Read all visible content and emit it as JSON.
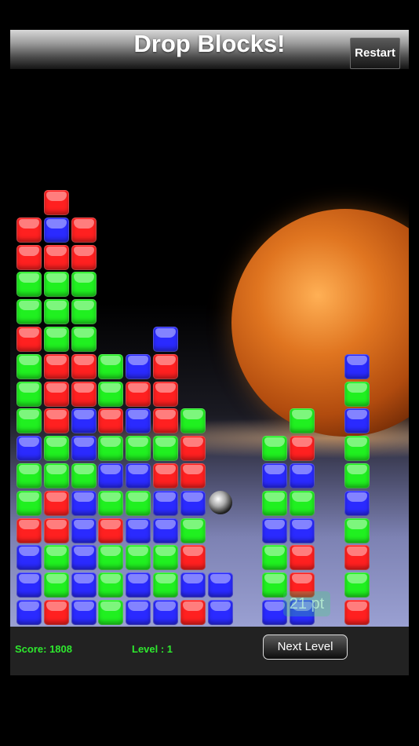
{
  "header": {
    "title": "Drop Blocks!",
    "restart_label": "Restart"
  },
  "board": {
    "colors": {
      "R": "#ff2020",
      "G": "#20f020",
      "B": "#2a2aff"
    },
    "columns": [
      [
        "B",
        "B",
        "B",
        "R",
        "G",
        "G",
        "B",
        "G",
        "G",
        "G",
        "R",
        "G",
        "G",
        "R",
        "R"
      ],
      [
        "R",
        "G",
        "G",
        "R",
        "R",
        "G",
        "G",
        "R",
        "R",
        "R",
        "G",
        "G",
        "G",
        "R",
        "B",
        "R"
      ],
      [
        "B",
        "B",
        "B",
        "B",
        "B",
        "G",
        "B",
        "B",
        "R",
        "R",
        "G",
        "G",
        "G",
        "R",
        "R"
      ],
      [
        "G",
        "G",
        "G",
        "R",
        "G",
        "B",
        "G",
        "R",
        "G",
        "G"
      ],
      [
        "B",
        "B",
        "G",
        "B",
        "G",
        "B",
        "G",
        "B",
        "R",
        "B"
      ],
      [
        "B",
        "G",
        "G",
        "B",
        "B",
        "R",
        "G",
        "R",
        "R",
        "R",
        "B"
      ],
      [
        "R",
        "B",
        "R",
        "G",
        "B",
        "R",
        "R",
        "G"
      ],
      [
        "B",
        "B"
      ],
      [],
      [
        "B",
        "G",
        "G",
        "B",
        "G",
        "B",
        "G"
      ],
      [
        "B",
        "R",
        "R",
        "B",
        "G",
        "B",
        "R",
        "G"
      ],
      [],
      [
        "R",
        "G",
        "R",
        "G",
        "B",
        "G",
        "G",
        "B",
        "G",
        "B"
      ]
    ],
    "floating_points": "21 pt"
  },
  "footer": {
    "score": "Score: 1808",
    "level": "Level : 1",
    "next_level_label": "Next Level"
  }
}
